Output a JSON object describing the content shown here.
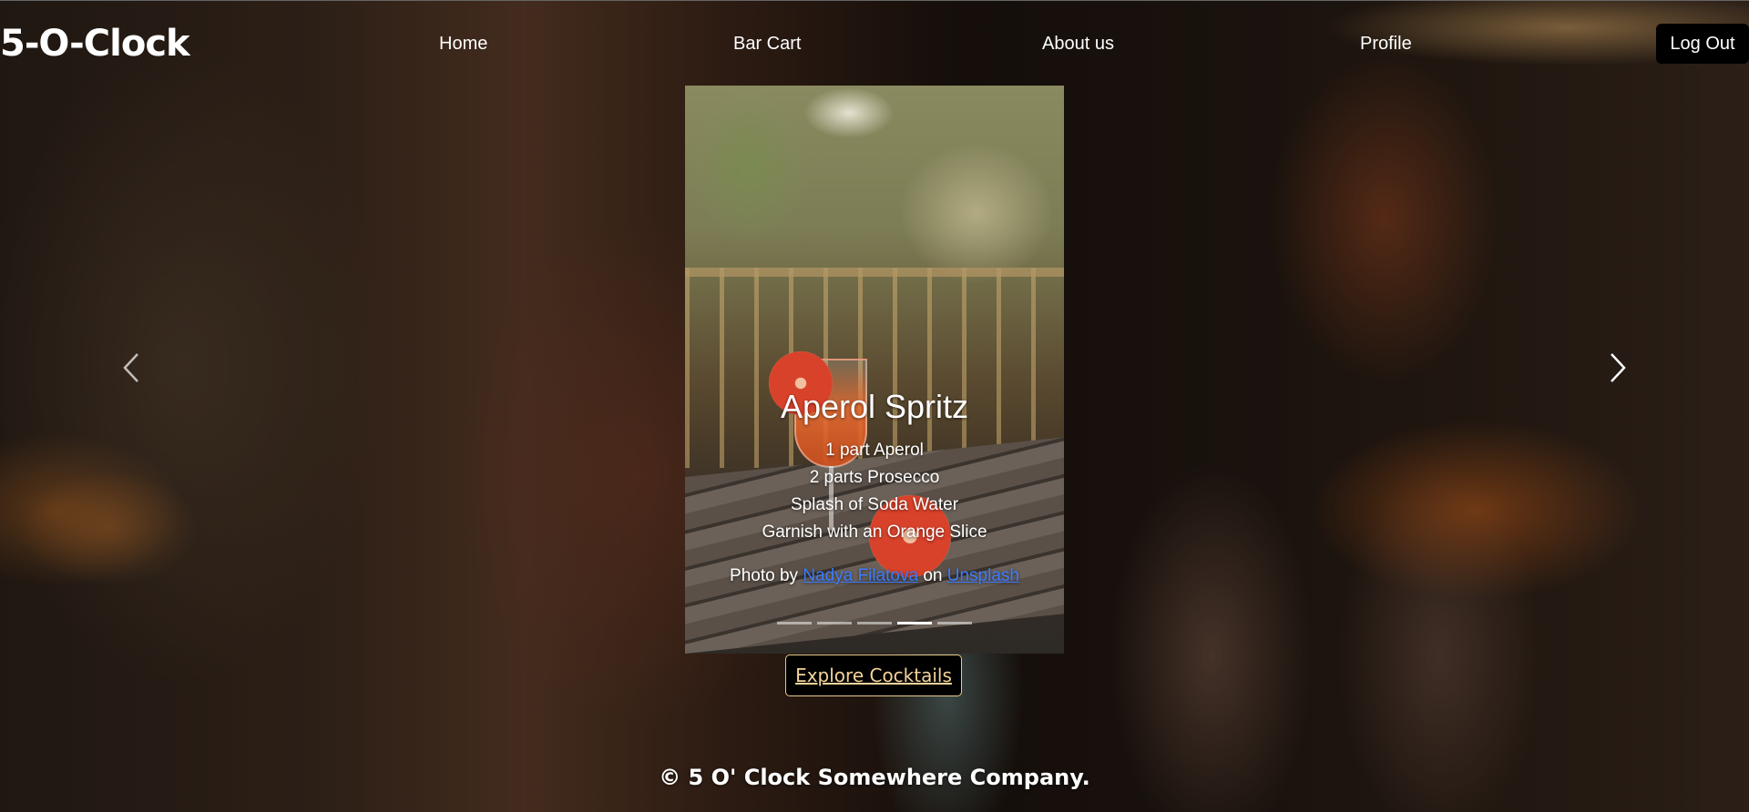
{
  "brand": "5-O-Clock",
  "nav": {
    "home": "Home",
    "bar_cart": "Bar Cart",
    "about": "About us",
    "profile": "Profile",
    "logout": "Log Out"
  },
  "carousel": {
    "title": "Aperol Spritz",
    "ingredients": [
      "1 part Aperol",
      "2 parts Prosecco",
      "Splash of Soda Water",
      "Garnish with an Orange Slice"
    ],
    "credit_prefix": "Photo by",
    "photographer": "Nadya Filatova",
    "credit_middle": "on",
    "source": "Unsplash",
    "active_slide_index": 3,
    "slide_count": 5
  },
  "explore_button": "Explore Cocktails",
  "footer": "© 5 O' Clock Somewhere Company."
}
